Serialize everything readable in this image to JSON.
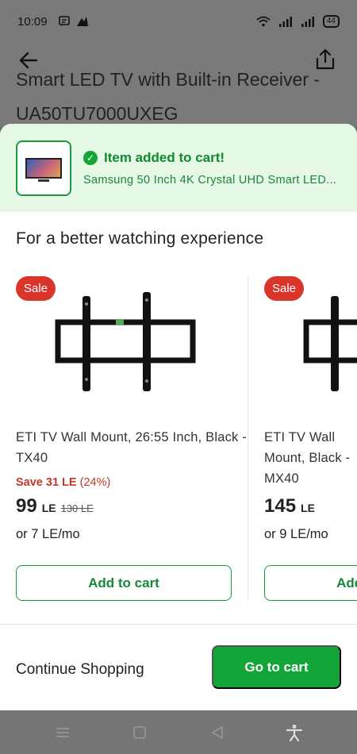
{
  "status_bar": {
    "time": "10:09",
    "battery": "44"
  },
  "background_page": {
    "title_line1": "Smart LED TV with Built-in Receiver -",
    "title_line2": "UA50TU7000UXEG"
  },
  "banner": {
    "title": "Item added to cart!",
    "subtitle": "Samsung 50 Inch 4K Crystal UHD Smart LED..."
  },
  "section_title": "For a better watching experience",
  "products": [
    {
      "badge": "Sale",
      "name": "ETI TV Wall Mount, 26:55 Inch, Black - TX40",
      "save": "Save 31 LE",
      "save_pct": "(24%)",
      "price": "99",
      "currency": "LE",
      "old_price": "130 LE",
      "monthly": "or 7 LE/mo",
      "add_label": "Add to cart"
    },
    {
      "badge": "Sale",
      "name": "ETI TV Wall Mount, Black - MX40",
      "price": "145",
      "currency": "LE",
      "monthly": "or 9 LE/mo",
      "add_label": "Add to cart"
    }
  ],
  "footer": {
    "continue_label": "Continue Shopping",
    "goto_label": "Go to cart"
  },
  "icons": {
    "back": "arrow-left-icon",
    "share": "share-icon",
    "check": "check-circle-icon"
  },
  "colors": {
    "accent_green": "#13a538",
    "sale_red": "#d9352b",
    "banner_bg": "#e6f8e6"
  }
}
